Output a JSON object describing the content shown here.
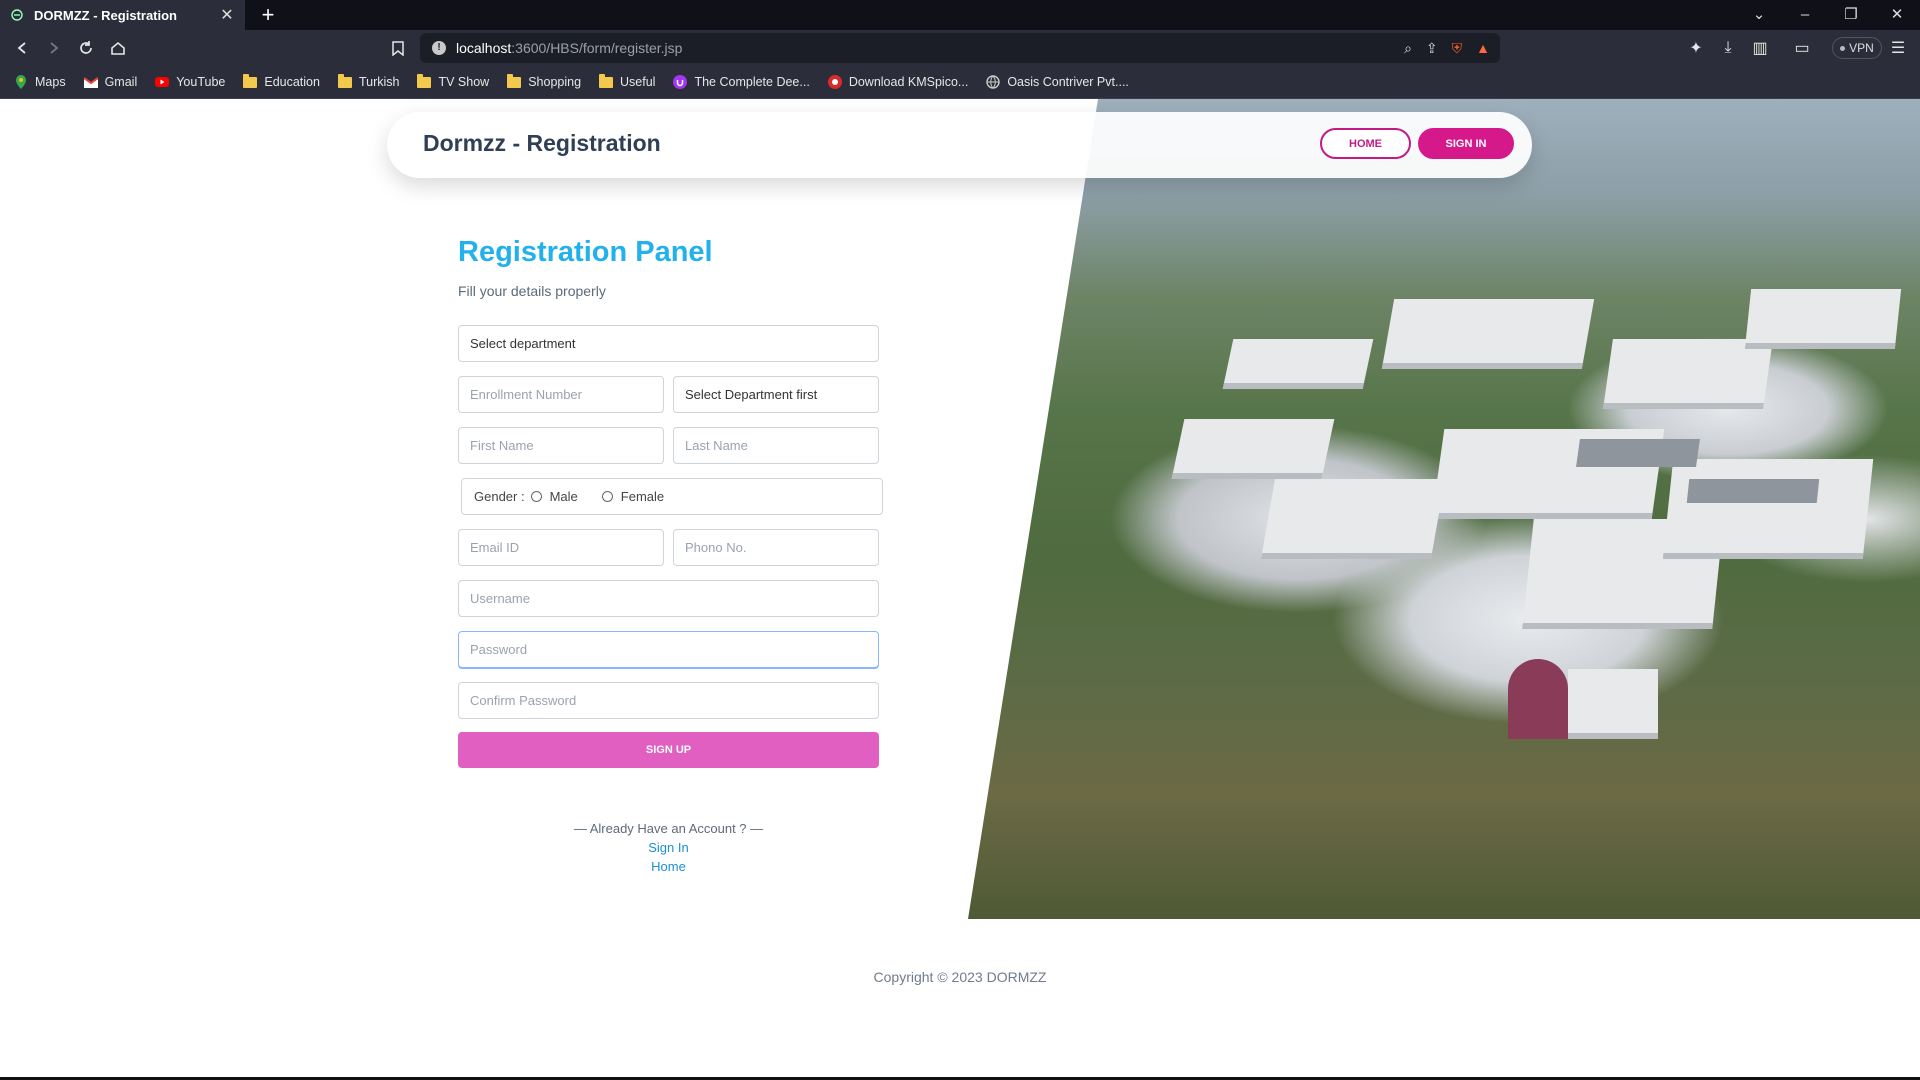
{
  "browser": {
    "tab_title": "DORMZZ - Registration",
    "url_host": "localhost",
    "url_path": ":3600/HBS/form/register.jsp",
    "vpn_label": "VPN",
    "bookmarks": [
      {
        "label": "Maps",
        "icon": "maps-icon"
      },
      {
        "label": "Gmail",
        "icon": "gmail-icon"
      },
      {
        "label": "YouTube",
        "icon": "youtube-icon"
      },
      {
        "label": "Education",
        "icon": "folder-icon"
      },
      {
        "label": "Turkish",
        "icon": "folder-icon"
      },
      {
        "label": "TV Show",
        "icon": "folder-icon"
      },
      {
        "label": "Shopping",
        "icon": "folder-icon"
      },
      {
        "label": "Useful",
        "icon": "folder-icon"
      },
      {
        "label": "The Complete Dee...",
        "icon": "udemy-icon"
      },
      {
        "label": "Download KMSpico...",
        "icon": "site-icon"
      },
      {
        "label": "Oasis Contriver Pvt....",
        "icon": "globe-icon"
      }
    ]
  },
  "nav": {
    "brand": "Dormzz - Registration",
    "home": "HOME",
    "signin": "SIGN IN"
  },
  "panel": {
    "title": "Registration Panel",
    "subtitle": "Fill your details properly"
  },
  "form": {
    "department": "Select department",
    "enrollment_placeholder": "Enrollment Number",
    "subdept": "Select Department first",
    "first_name_placeholder": "First Name",
    "last_name_placeholder": "Last Name",
    "gender_label": "Gender :",
    "gender_male": "Male",
    "gender_female": "Female",
    "email_placeholder": "Email ID",
    "phone_placeholder": "Phono No.",
    "username_placeholder": "Username",
    "password_placeholder": "Password",
    "confirm_placeholder": "Confirm Password",
    "submit": "SIGN UP"
  },
  "footer_links": {
    "already": "— Already Have an Account ? —",
    "signin": "Sign In",
    "home": "Home"
  },
  "copyright": "Copyright © 2023 DORMZZ",
  "colors": {
    "accent_blue": "#22b1ec",
    "brand_pink": "#d6198a",
    "signup_pink": "#e05fc0"
  }
}
